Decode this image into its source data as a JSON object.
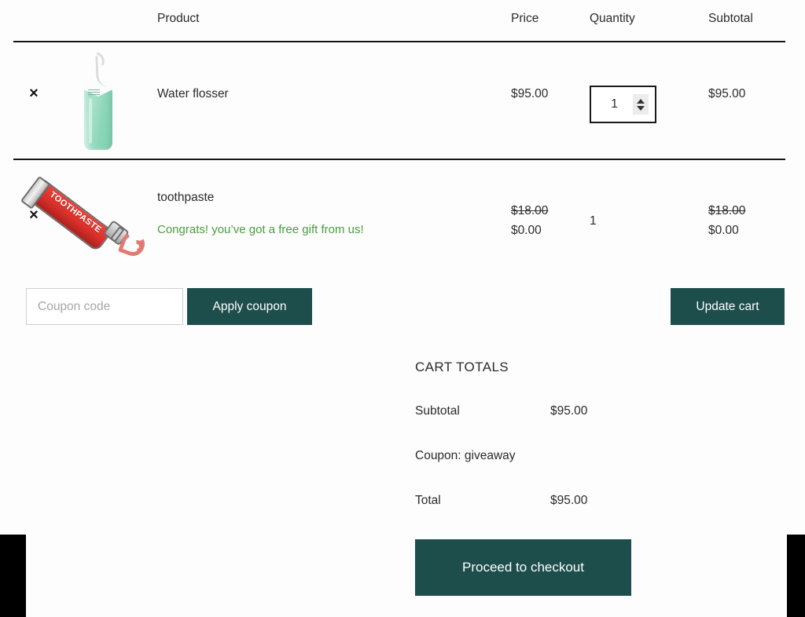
{
  "table": {
    "headers": {
      "product": "Product",
      "price": "Price",
      "quantity": "Quantity",
      "subtotal": "Subtotal"
    },
    "remove_symbol": "×",
    "rows": [
      {
        "name": "Water flosser",
        "thumb_icon": "water-flosser-image",
        "price": "$95.00",
        "quantity": "1",
        "subtotal": "$95.00"
      },
      {
        "name": "toothpaste",
        "thumb_icon": "toothpaste-tube-image",
        "thumb_text": "TOOTHPASTE",
        "gift_note": "Congrats! you’ve got a free gift from us!",
        "price_original": "$18.00",
        "price_discounted": "$0.00",
        "quantity": "1",
        "subtotal_original": "$18.00",
        "subtotal_discounted": "$0.00"
      }
    ]
  },
  "coupon": {
    "placeholder": "Coupon code",
    "value": "",
    "apply_label": "Apply coupon"
  },
  "actions": {
    "update_cart_label": "Update cart"
  },
  "cart_totals": {
    "title": "CART TOTALS",
    "rows": [
      {
        "label": "Subtotal",
        "value": "$95.00"
      },
      {
        "label": "Coupon: giveaway",
        "value": ""
      },
      {
        "label": "Total",
        "value": "$95.00"
      }
    ],
    "checkout_label": "Proceed to checkout"
  },
  "colors": {
    "button": "#1d4e4c",
    "gift_text": "#4a9e3f",
    "rule": "#151515",
    "background": "#fdfdfd"
  }
}
